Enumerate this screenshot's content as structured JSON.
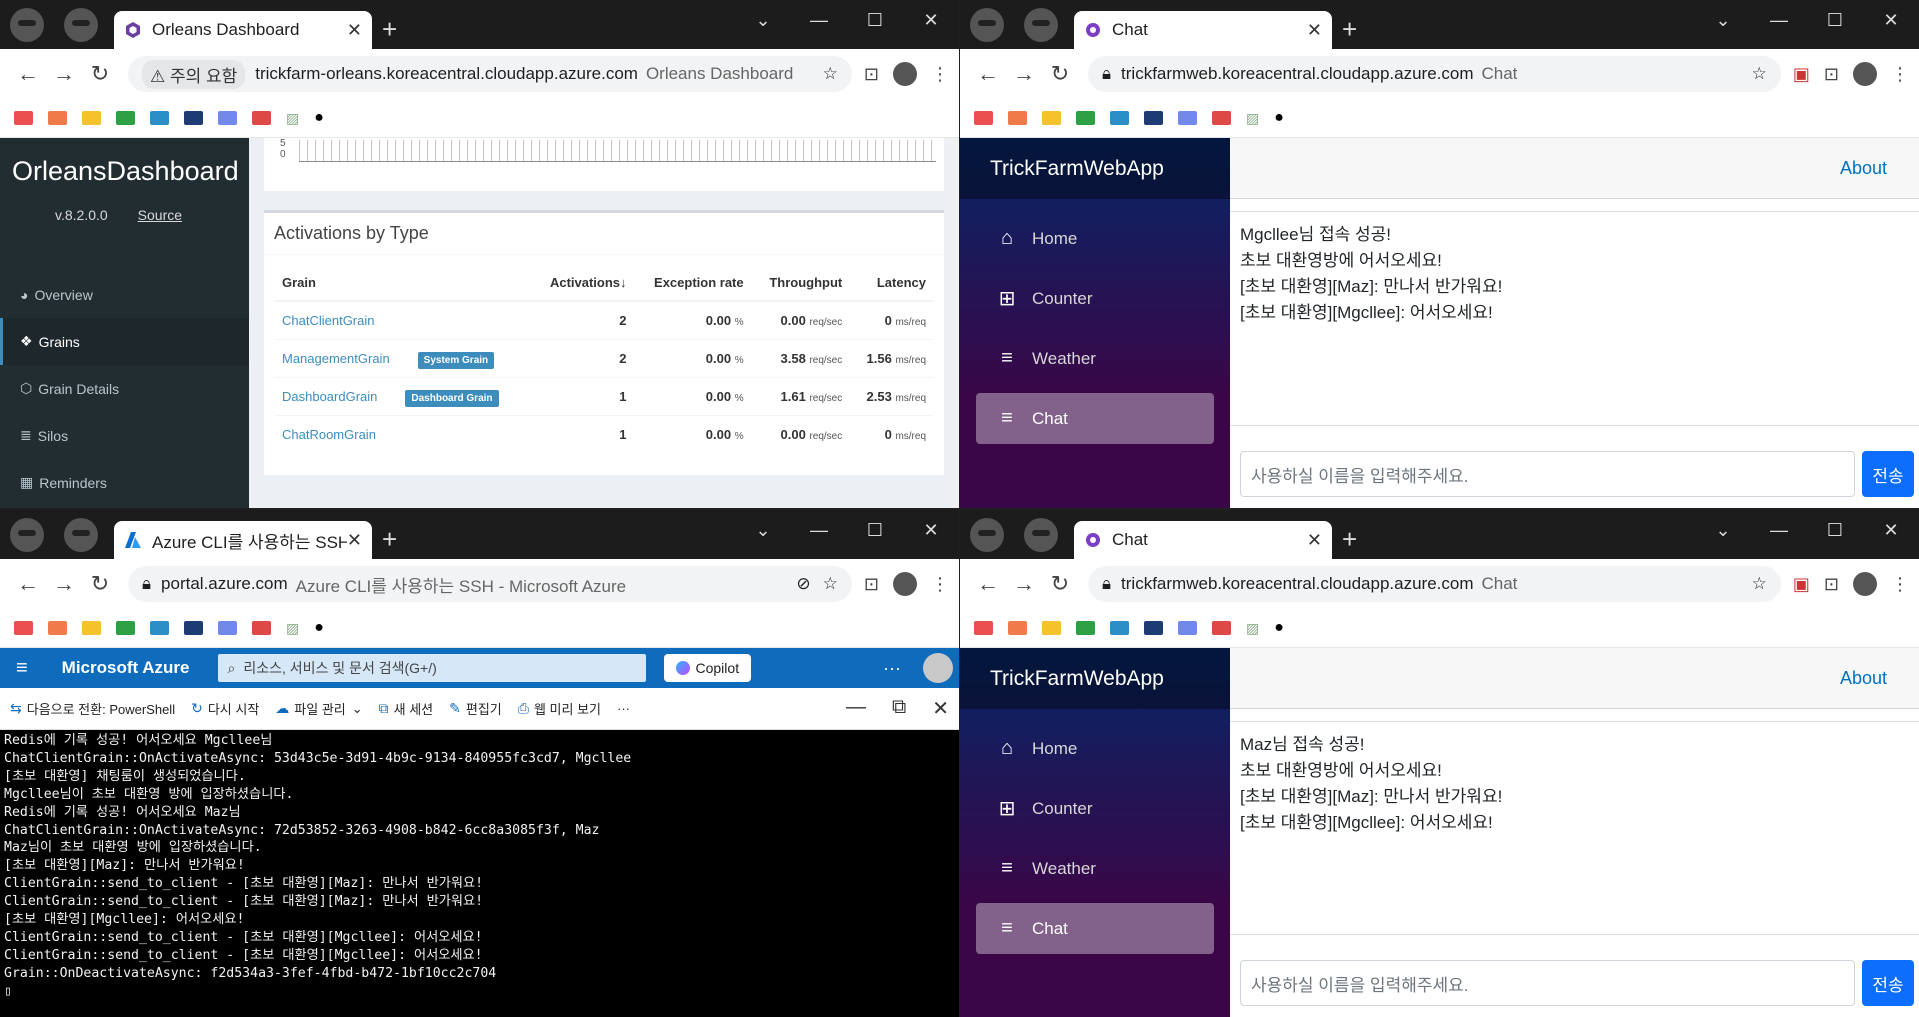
{
  "windows": {
    "orleans": {
      "tab_title": "Orleans Dashboard",
      "security_label": "주의 요함",
      "url": "trickfarm-orleans.koreacentral.cloudapp.azure.com",
      "url_title": "Orleans Dashboard",
      "sidebar": {
        "logo": "OrleansDashboard",
        "version": "v.8.2.0.0",
        "source_link": "Source",
        "items": [
          {
            "label": "Overview",
            "icon": "dashboard-icon"
          },
          {
            "label": "Grains",
            "icon": "cubes-icon"
          },
          {
            "label": "Grain Details",
            "icon": "cube-icon"
          },
          {
            "label": "Silos",
            "icon": "database-icon"
          },
          {
            "label": "Reminders",
            "icon": "calendar-icon"
          }
        ]
      },
      "chart_axis": {
        "top": "5",
        "bottom": "0"
      },
      "activations": {
        "title": "Activations by Type",
        "columns": [
          "Grain",
          "Activations",
          "Exception rate",
          "Throughput",
          "Latency"
        ],
        "sort_indicator": "↓",
        "rows": [
          {
            "grain": "ChatClientGrain",
            "badge": "",
            "activations": "2",
            "exception": "0.00",
            "exception_unit": "%",
            "throughput": "0.00",
            "throughput_unit": "req/sec",
            "latency": "0",
            "latency_unit": "ms/req"
          },
          {
            "grain": "ManagementGrain",
            "badge": "System Grain",
            "activations": "2",
            "exception": "0.00",
            "exception_unit": "%",
            "throughput": "3.58",
            "throughput_unit": "req/sec",
            "latency": "1.56",
            "latency_unit": "ms/req"
          },
          {
            "grain": "DashboardGrain",
            "badge": "Dashboard Grain",
            "activations": "1",
            "exception": "0.00",
            "exception_unit": "%",
            "throughput": "1.61",
            "throughput_unit": "req/sec",
            "latency": "2.53",
            "latency_unit": "ms/req"
          },
          {
            "grain": "ChatRoomGrain",
            "badge": "",
            "activations": "1",
            "exception": "0.00",
            "exception_unit": "%",
            "throughput": "0.00",
            "throughput_unit": "req/sec",
            "latency": "0",
            "latency_unit": "ms/req"
          }
        ]
      }
    },
    "chat_top": {
      "tab_title": "Chat",
      "url": "trickfarmweb.koreacentral.cloudapp.azure.com",
      "url_title": "Chat",
      "brand": "TrickFarmWebApp",
      "nav": [
        "Home",
        "Counter",
        "Weather",
        "Chat"
      ],
      "about": "About",
      "messages": [
        "Mgcllee님 접속 성공!",
        "초보 대환영방에 어서오세요!",
        "[초보 대환영][Maz]: 만나서 반가워요!",
        "[초보 대환영][Mgcllee]: 어서오세요!"
      ],
      "input_placeholder": "사용하실 이름을 입력해주세요.",
      "send": "전송"
    },
    "azure": {
      "tab_title": "Azure CLI를 사용하는 SSH - M",
      "url": "portal.azure.com",
      "url_title": "Azure CLI를 사용하는 SSH - Microsoft Azure",
      "brand": "Microsoft Azure",
      "search_placeholder": "리소스, 서비스 및 문서 검색(G+/)",
      "copilot": "Copilot",
      "more": "···",
      "toolbar": [
        "다음으로 전환: PowerShell",
        "다시 시작",
        "파일 관리",
        "새 세션",
        "편집기",
        "웹 미리 보기",
        "···"
      ],
      "terminal": [
        "Redis에 기록 성공! 어서오세요 Mgcllee님",
        "ChatClientGrain::OnActivateAsync: 53d43c5e-3d91-4b9c-9134-840955fc3cd7, Mgcllee",
        "[초보 대환영] 채팅룸이 생성되었습니다.",
        "Mgcllee님이 초보 대환영 방에 입장하셨습니다.",
        "Redis에 기록 성공! 어서오세요 Maz님",
        "ChatClientGrain::OnActivateAsync: 72d53852-3263-4908-b842-6cc8a3085f3f, Maz",
        "Maz님이 초보 대환영 방에 입장하셨습니다.",
        "[초보 대환영][Maz]: 만나서 반가워요!",
        "ClientGrain::send_to_client - [초보 대환영][Maz]: 만나서 반가워요!",
        "ClientGrain::send_to_client - [초보 대환영][Maz]: 만나서 반가워요!",
        "[초보 대환영][Mgcllee]: 어서오세요!",
        "ClientGrain::send_to_client - [초보 대환영][Mgcllee]: 어서오세요!",
        "ClientGrain::send_to_client - [초보 대환영][Mgcllee]: 어서오세요!",
        "Grain::OnDeactivateAsync: f2d534a3-3fef-4fbd-b472-1bf10cc2c704",
        "▯"
      ]
    },
    "chat_bottom": {
      "tab_title": "Chat",
      "url": "trickfarmweb.koreacentral.cloudapp.azure.com",
      "url_title": "Chat",
      "brand": "TrickFarmWebApp",
      "nav": [
        "Home",
        "Counter",
        "Weather",
        "Chat"
      ],
      "about": "About",
      "messages": [
        "Maz님 접속 성공!",
        "초보 대환영방에 어서오세요!",
        "[초보 대환영][Maz]: 만나서 반가워요!",
        "[초보 대환영][Mgcllee]: 어서오세요!"
      ],
      "input_placeholder": "사용하실 이름을 입력해주세요.",
      "send": "전송"
    }
  },
  "bookmark_colors": [
    "#ec4f4f",
    "#f07b4a",
    "#f4c22b",
    "#2ea043",
    "#2b8ec7",
    "#1f3b73",
    "#7289ea",
    "#e04848"
  ],
  "colors": {
    "orleans_accent": "#3c8dbc",
    "blazor_button": "#0d6efd",
    "azure_blue": "#0f6cbd"
  }
}
